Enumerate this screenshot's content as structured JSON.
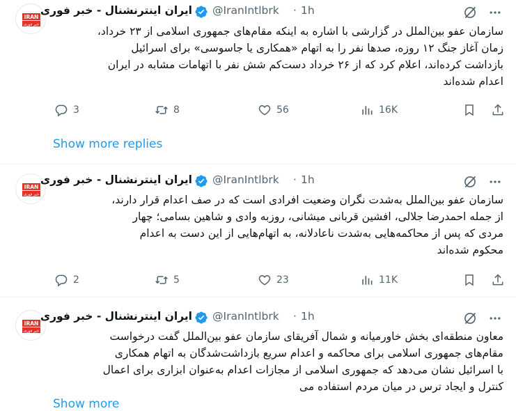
{
  "colors": {
    "accent": "#1d9bf0",
    "muted": "#536471",
    "brand_red": "#e0322a"
  },
  "tweets": [
    {
      "author_name": "ایران اینترنشنال - خبر فوری",
      "handle": "@IranIntlbrk",
      "dot": "·",
      "time": "1h",
      "avatar_text_top": "IRAN",
      "avatar_text_bottom": "خبر فوری",
      "lines": [
        "سازمان عفو بین‌الملل در گزارشی با اشاره به اینکه مقام‌های جمهوری اسلامی از ۲۳ خرداد،",
        "زمان آغاز جنگ ۱۲ روزه، صدها نفر را به اتهام «همکاری یا جاسوسی» برای اسرائیل",
        "بازداشت کرده‌اند، اعلام کرد که از ۲۶ خرداد دست‌کم شش نفر با اتهامات مشابه در ایران",
        "اعدام شده‌اند"
      ],
      "replies": "3",
      "reposts": "8",
      "likes": "56",
      "views": "16K"
    },
    {
      "author_name": "ایران اینترنشنال - خبر فوری",
      "handle": "@IranIntlbrk",
      "dot": "·",
      "time": "1h",
      "avatar_text_top": "IRAN",
      "avatar_text_bottom": "خبر فوری",
      "lines": [
        "سازمان عفو بین‌الملل به‌شدت نگران وضعیت افرادی است که در صف اعدام قرار دارند،",
        "از جمله احمدرضا جلالی، افشین قربانی میشانی، روزبه وادی و شاهین بسامی؛ چهار",
        "مردی که پس از محاکمه‌هایی به‌شدت ناعادلانه، به اتهام‌هایی از این دست به اعدام",
        "محکوم شده‌اند"
      ],
      "replies": "2",
      "reposts": "5",
      "likes": "23",
      "views": "11K"
    },
    {
      "author_name": "ایران اینترنشنال - خبر فوری",
      "handle": "@IranIntlbrk",
      "dot": "·",
      "time": "1h",
      "avatar_text_top": "IRAN",
      "avatar_text_bottom": "خبر فوری",
      "lines": [
        "معاون منطقه‌ای بخش خاورمیانه و شمال آفریقای سازمان عفو بین‌الملل گفت درخواست",
        "مقام‌های جمهوری اسلامی برای محاکمه و اعدام سریع بازداشت‌شدگان به اتهام همکاری",
        "با اسرائیل نشان می‌دهد که جمهوری اسلامی از مجازات اعدام به‌عنوان ابزاری برای اعمال",
        "کنترل و ایجاد ترس در میان مردم استفاده می"
      ]
    }
  ],
  "show_more_replies": "Show more replies",
  "show_more": "Show more"
}
